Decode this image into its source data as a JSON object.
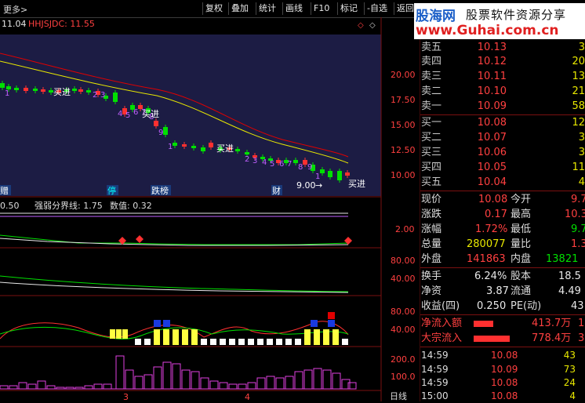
{
  "toolbar": {
    "more": "更多",
    "buttons": [
      "复权",
      "叠加",
      "统计",
      "画线",
      "F10",
      "标记",
      "-自选",
      "返回"
    ]
  },
  "chart": {
    "header_price": "11.04",
    "header_code": "HHJSJDC: 11.55",
    "price_axis": [
      "20.00",
      "17.50",
      "15.00",
      "12.50",
      "10.00"
    ],
    "buy_label": "买进",
    "low_label": "9.00",
    "event_labels": [
      "赠",
      "停",
      "跌榜",
      "财"
    ],
    "strength_label": "强弱分界线: 1.75",
    "value_label": "数值: 0.32",
    "strength_left": "0.50",
    "mid_axis": "2.00",
    "ind2_axis": [
      "80.00",
      "40.00"
    ],
    "ind3_axis": [
      "80.00",
      "40.00"
    ],
    "ind4_axis": [
      "200.0",
      "100.0"
    ],
    "bottom_ticks": [
      "3",
      "4"
    ],
    "period": "日线",
    "td_numbers": [
      "1",
      "2",
      "3",
      "4",
      "5",
      "6",
      "7",
      "8",
      "9"
    ],
    "colors": {
      "up": "#00e000",
      "down": "#ff3030",
      "ma1": "#e8e800",
      "ma2": "#e00000",
      "bg": "#1a1a40"
    }
  },
  "logo": {
    "site": "股海网",
    "tagline": "股票软件资源分享",
    "url": "www.Guhai.com.cn"
  },
  "order_book": {
    "asks": [
      {
        "label": "卖五",
        "price": "10.13",
        "qty": "3"
      },
      {
        "label": "卖四",
        "price": "10.12",
        "qty": "20"
      },
      {
        "label": "卖三",
        "price": "10.11",
        "qty": "13"
      },
      {
        "label": "卖二",
        "price": "10.10",
        "qty": "21"
      },
      {
        "label": "卖一",
        "price": "10.09",
        "qty": "58"
      }
    ],
    "bids": [
      {
        "label": "买一",
        "price": "10.08",
        "qty": "12"
      },
      {
        "label": "买二",
        "price": "10.07",
        "qty": "3"
      },
      {
        "label": "买三",
        "price": "10.06",
        "qty": "3"
      },
      {
        "label": "买四",
        "price": "10.05",
        "qty": "11"
      },
      {
        "label": "买五",
        "price": "10.04",
        "qty": "4"
      }
    ]
  },
  "quote": {
    "rows": [
      {
        "l1": "现价",
        "v1": "10.08",
        "l2": "今开",
        "v2": "9.7"
      },
      {
        "l1": "涨跌",
        "v1": "0.17",
        "l2": "最高",
        "v2": "10.3"
      },
      {
        "l1": "涨幅",
        "v1": "1.72%",
        "l2": "最低",
        "v2": "9.7"
      },
      {
        "l1": "总量",
        "v1": "280077",
        "l2": "量比",
        "v2": "1.3"
      },
      {
        "l1": "外盘",
        "v1": "141863",
        "l2": "内盘",
        "v2": "13821"
      }
    ],
    "rows2": [
      {
        "l1": "换手",
        "v1": "6.24%",
        "l2": "股本",
        "v2": "18.5"
      },
      {
        "l1": "净资",
        "v1": "3.87",
        "l2": "流通",
        "v2": "4.49"
      },
      {
        "l1": "收益(四)",
        "v1": "0.250",
        "l2": "PE(动)",
        "v2": "43"
      }
    ],
    "flows": [
      {
        "label": "净流入额",
        "value": "413.7万",
        "extra": "1",
        "bar": 0.35
      },
      {
        "label": "大宗流入",
        "value": "778.4万",
        "extra": "3",
        "bar": 0.65
      }
    ]
  },
  "trades": [
    {
      "time": "14:59",
      "price": "10.08",
      "vol": "43"
    },
    {
      "time": "14:59",
      "price": "10.09",
      "vol": "73"
    },
    {
      "time": "14:59",
      "price": "10.08",
      "vol": "24"
    },
    {
      "time": "15:00",
      "price": "10.08",
      "vol": "4"
    }
  ]
}
